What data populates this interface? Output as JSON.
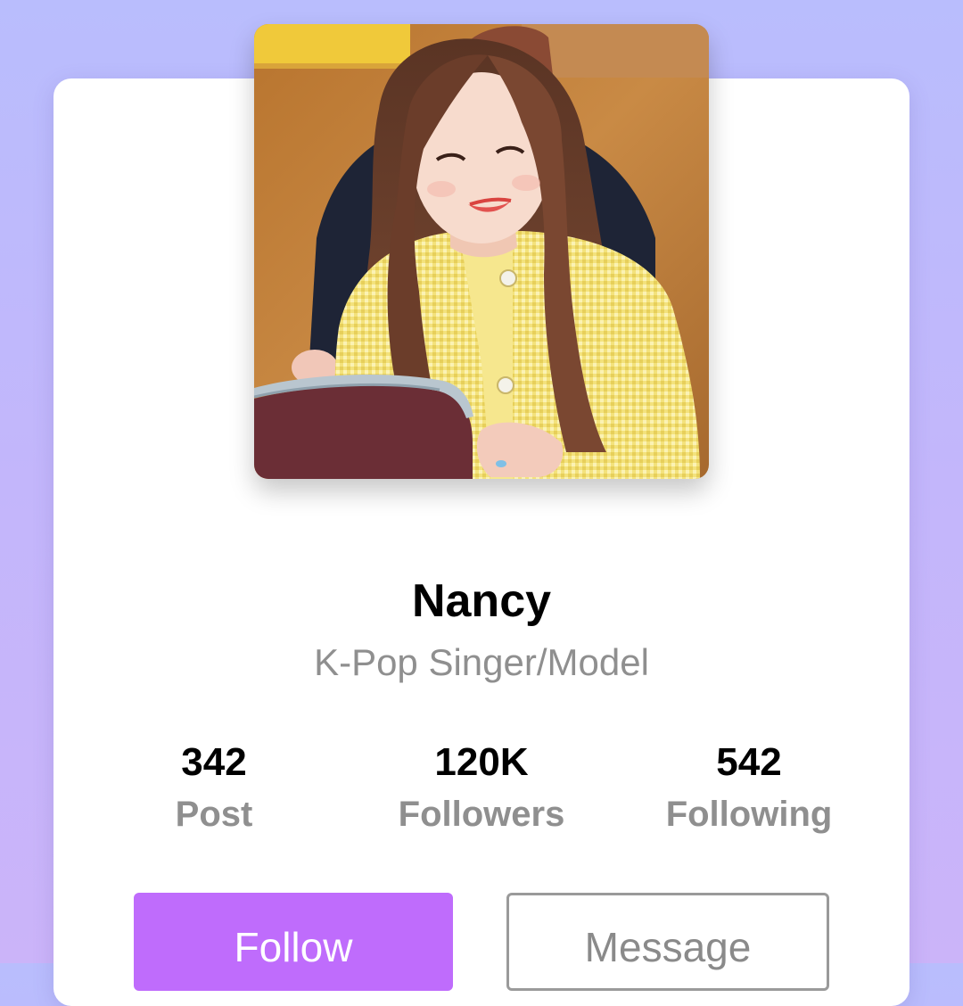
{
  "colors": {
    "background_top": "#b9bdfd",
    "background_bottom": "#cbb4f9",
    "card": "#ffffff",
    "accent": "#bf6cfc",
    "secondary_text": "#8f8f8f"
  },
  "profile": {
    "photo_icon": "profile-photo",
    "name": "Nancy",
    "role": "K-Pop Singer/Model"
  },
  "stats": [
    {
      "value": "342",
      "label": "Post"
    },
    {
      "value": "120K",
      "label": "Followers"
    },
    {
      "value": "542",
      "label": "Following"
    }
  ],
  "actions": {
    "follow_label": "Follow",
    "message_label": "Message"
  }
}
